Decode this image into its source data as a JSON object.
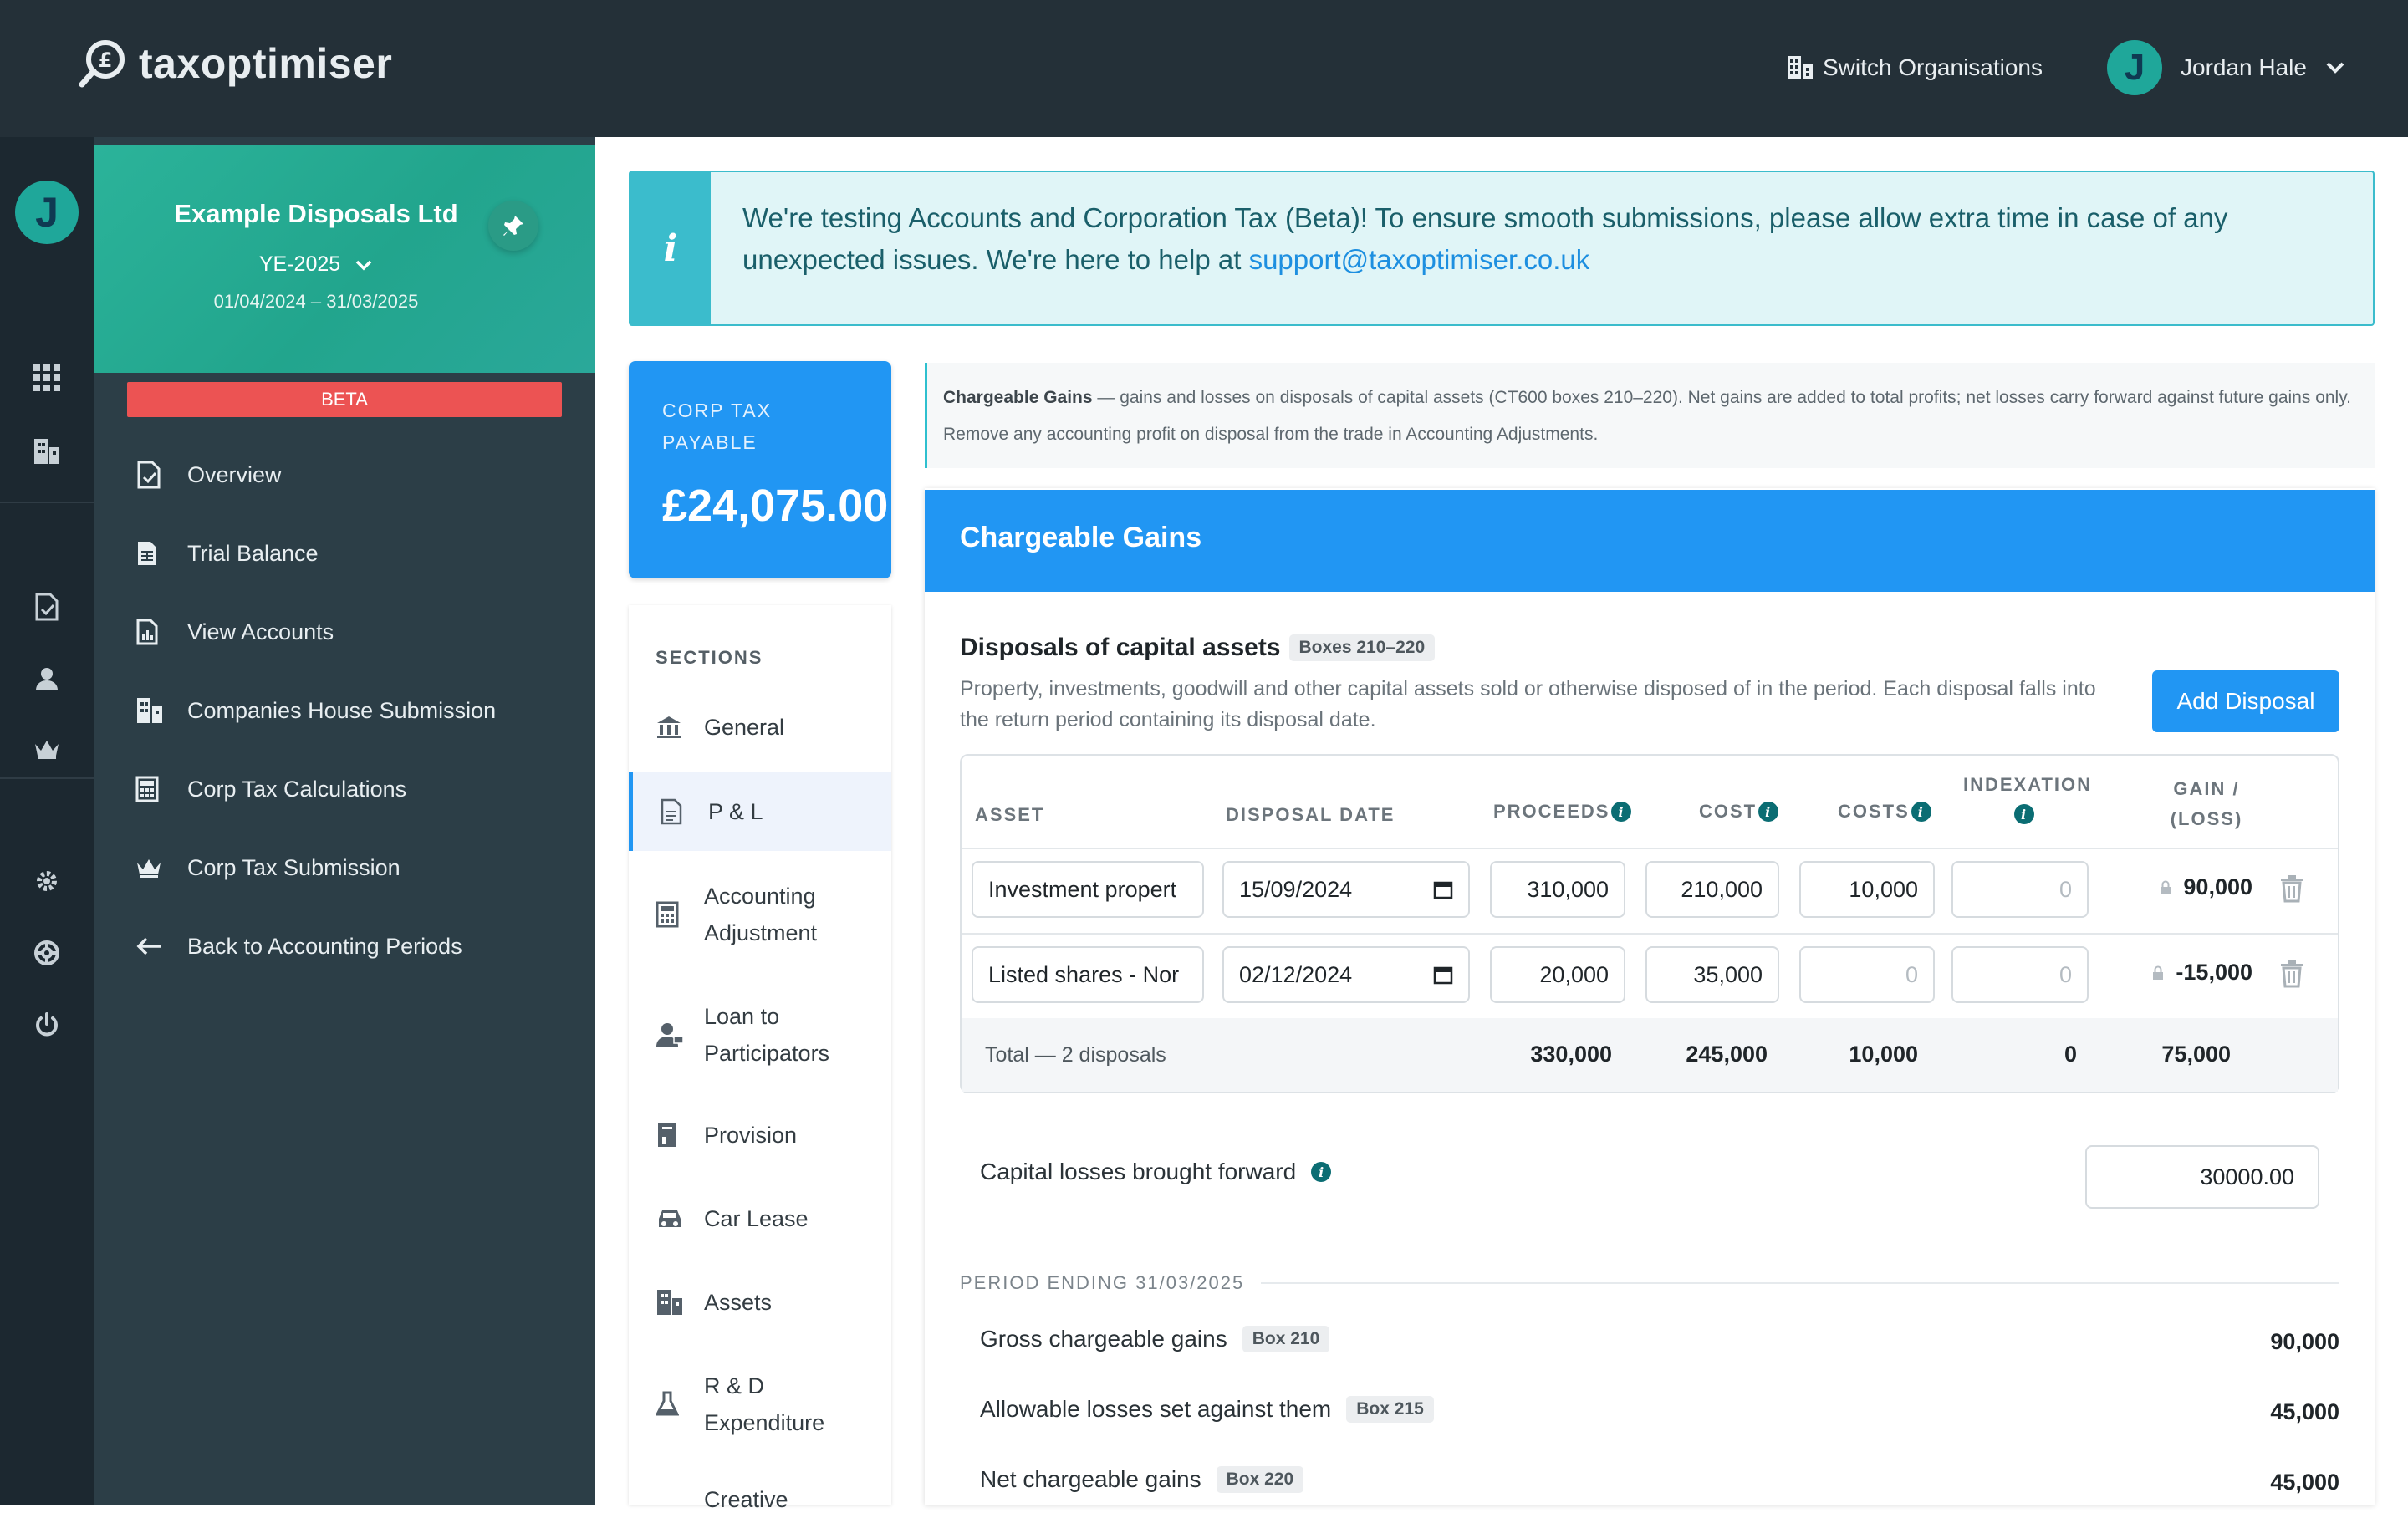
{
  "app": {
    "logo_text": "taxoptimiser"
  },
  "header": {
    "switch_org": "Switch Organisations",
    "user_initial": "J",
    "user_name": "Jordan Hale"
  },
  "rail": {
    "avatar_initial": "J"
  },
  "org": {
    "name": "Example Disposals Ltd",
    "year": "YE-2025",
    "dates": "01/04/2024 – 31/03/2025",
    "badge": "BETA"
  },
  "nav": {
    "items": [
      {
        "label": "Overview",
        "icon": "document-check-icon"
      },
      {
        "label": "Trial Balance",
        "icon": "spreadsheet-icon"
      },
      {
        "label": "View Accounts",
        "icon": "report-chart-icon"
      },
      {
        "label": "Companies House Submission",
        "icon": "buildings-icon"
      },
      {
        "label": "Corp Tax Calculations",
        "icon": "calculator-icon"
      },
      {
        "label": "Corp Tax Submission",
        "icon": "crown-icon"
      },
      {
        "label": "Back to Accounting Periods",
        "icon": "arrow-left-icon"
      }
    ]
  },
  "banner": {
    "text": "We're testing Accounts and Corporation Tax (Beta)! To ensure smooth submissions, please allow extra time in case of any unexpected issues. We're here to help at ",
    "link": "support@taxoptimiser.co.uk"
  },
  "corp_tax": {
    "label": "CORP TAX PAYABLE",
    "value": "£24,075.00"
  },
  "sections": {
    "title": "SECTIONS",
    "items": [
      {
        "label": "General",
        "icon": "bank-icon"
      },
      {
        "label": "P & L",
        "icon": "document-icon"
      },
      {
        "label": "Accounting Adjustment",
        "icon": "calculator-icon"
      },
      {
        "label": "Loan to Participators",
        "icon": "user-loan-icon"
      },
      {
        "label": "Provision",
        "icon": "book-icon"
      },
      {
        "label": "Car Lease",
        "icon": "car-icon"
      },
      {
        "label": "Assets",
        "icon": "buildings-icon"
      },
      {
        "label": "R & D Expenditure",
        "icon": "flask-icon"
      },
      {
        "label": "Creative",
        "icon": "palette-icon"
      }
    ]
  },
  "description": {
    "bold": "Chargeable Gains",
    "text": " — gains and losses on disposals of capital assets (CT600 boxes 210–220). Net gains are added to total profits; net losses carry forward against future gains only. Remove any accounting profit on disposal from the trade in Accounting Adjustments."
  },
  "cg": {
    "title": "Chargeable Gains",
    "disposals_title": "Disposals of capital assets",
    "boxes_pill": "Boxes 210–220",
    "disposals_desc": "Property, investments, goodwill and other capital assets sold or otherwise disposed of in the period. Each disposal falls into the return period containing its disposal date.",
    "add_button": "Add Disposal",
    "columns": {
      "asset": "ASSET",
      "date": "DISPOSAL DATE",
      "proceeds": "PROCEEDS",
      "cost": "COST",
      "costs": "COSTS",
      "indexation": "INDEXATION",
      "gain_line1": "GAIN /",
      "gain_line2": "(LOSS)"
    },
    "rows": [
      {
        "asset": "Investment propert",
        "date": "15/09/2024",
        "proceeds": "310,000",
        "cost": "210,000",
        "costs": "10,000",
        "indexation": "0",
        "gain": "90,000"
      },
      {
        "asset": "Listed shares - Nor",
        "date": "02/12/2024",
        "proceeds": "20,000",
        "cost": "35,000",
        "costs": "0",
        "indexation": "0",
        "gain": "-15,000"
      }
    ],
    "total": {
      "label": "Total — 2 disposals",
      "proceeds": "330,000",
      "cost": "245,000",
      "costs": "10,000",
      "indexation": "0",
      "gain": "75,000"
    },
    "capital_losses_label": "Capital losses brought forward",
    "capital_losses_value": "30000.00",
    "period_title": "PERIOD ENDING 31/03/2025",
    "summary": [
      {
        "label": "Gross chargeable gains",
        "box": "Box 210",
        "value": "90,000"
      },
      {
        "label": "Allowable losses set against them",
        "box": "Box 215",
        "value": "45,000"
      },
      {
        "label": "Net chargeable gains",
        "box": "Box 220",
        "value": "45,000"
      }
    ]
  },
  "colors": {
    "topbar": "#243038",
    "sidepanel": "#2c3e47",
    "accent_blue": "#2196f3",
    "teal": "#22a58d",
    "beta_red": "#ec5353"
  }
}
